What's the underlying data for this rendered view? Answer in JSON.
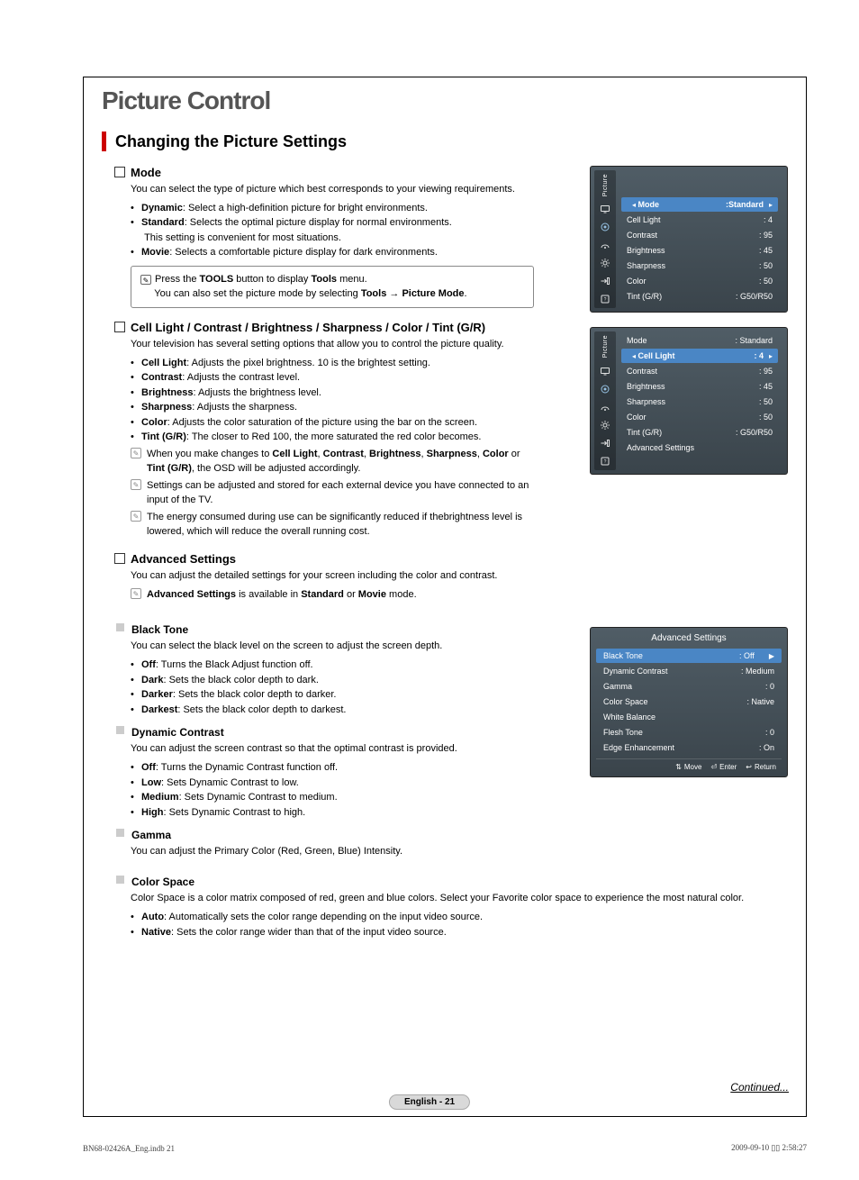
{
  "section_title": "Picture Control",
  "subsection_title": "Changing the Picture Settings",
  "mode": {
    "heading": "Mode",
    "intro": "You can select the type of picture which best corresponds to your viewing requirements.",
    "items": [
      {
        "name": "Dynamic",
        "desc": ": Select a high-definition picture for bright environments."
      },
      {
        "name": "Standard",
        "desc": ": Selects the optimal picture display for normal environments.",
        "desc2": "This setting is convenient for most situations."
      },
      {
        "name": "Movie",
        "desc": ": Selects a comfortable picture display for dark environments."
      }
    ],
    "note_line1_a": "Press the",
    "note_tools": "TOOLS",
    "note_line1_b": "button to display",
    "note_tools2": "Tools",
    "note_line1_c": "menu.",
    "note_line2_a": "You can also set the picture mode by selecting",
    "note_path": "Tools → Picture Mode"
  },
  "cell": {
    "heading": "Cell Light / Contrast / Brightness / Sharpness / Color / Tint (G/R)",
    "intro": "Your television has several setting options that allow you to control the picture quality.",
    "items": [
      {
        "name": "Cell Light",
        "desc": ": Adjusts the pixel brightness. 10 is the brightest setting."
      },
      {
        "name": "Contrast",
        "desc": ": Adjusts the contrast level."
      },
      {
        "name": "Brightness",
        "desc": ": Adjusts the brightness level."
      },
      {
        "name": "Sharpness",
        "desc": ": Adjusts the sharpness."
      },
      {
        "name": "Color",
        "desc": ": Adjusts the color saturation of the picture using the bar on the screen."
      },
      {
        "name": "Tint (G/R)",
        "desc": ": The closer to Red 100, the more saturated the red color becomes."
      }
    ],
    "note1_a": "When you make changes to",
    "note1_b": "Cell Light",
    "note1_c": "Contrast",
    "note1_d": "Brightness",
    "note1_e": "Sharpness",
    "note1_f": "Color",
    "note1_g": "or",
    "note1_h": "Tint (G/R)",
    "note1_i": ", the OSD will be adjusted accordingly.",
    "note2": "Settings can be adjusted and stored for each external device you have connected to an input of the TV.",
    "note3": "The energy consumed during use can be significantly reduced if thebrightness level is lowered, which will reduce the overall running cost."
  },
  "adv": {
    "heading": "Advanced Settings",
    "intro": "You can adjust the detailed settings for your screen including the color and contrast.",
    "note_bold": "Advanced Settings",
    "note_a": "is available in",
    "note_b": "Standard",
    "note_or": "or",
    "note_c": "Movie",
    "note_d": "mode."
  },
  "bt": {
    "heading": "Black Tone",
    "intro": "You can select the black level on the screen to adjust the screen depth.",
    "items": [
      {
        "name": "Off",
        "desc": ": Turns the Black Adjust function off."
      },
      {
        "name": "Dark",
        "desc": ": Sets the black color depth to dark."
      },
      {
        "name": "Darker",
        "desc": ": Sets the black color depth to darker."
      },
      {
        "name": "Darkest",
        "desc": ": Sets the black color depth to darkest."
      }
    ]
  },
  "dc": {
    "heading": "Dynamic Contrast",
    "intro": "You can adjust the screen contrast so that the optimal contrast is provided.",
    "items": [
      {
        "name": "Off",
        "desc": ": Turns the Dynamic Contrast function off."
      },
      {
        "name": "Low",
        "desc": ": Sets Dynamic Contrast to low."
      },
      {
        "name": "Medium",
        "desc": ": Sets Dynamic Contrast to medium."
      },
      {
        "name": "High",
        "desc": ": Sets Dynamic Contrast to high."
      }
    ]
  },
  "gamma": {
    "heading": "Gamma",
    "intro": "You can adjust the Primary Color (Red, Green, Blue) Intensity."
  },
  "cs": {
    "heading": "Color Space",
    "intro": "Color Space is a color matrix composed of red, green and blue colors. Select your Favorite color space to experience the most natural color.",
    "items": [
      {
        "name": "Auto",
        "desc": ": Automatically sets the color range depending on the input video source."
      },
      {
        "name": "Native",
        "desc": ": Sets the color range wider than that of the input video source."
      }
    ]
  },
  "osd1": {
    "side": "Picture",
    "rows": [
      {
        "lbl": "Mode",
        "val": ":Standard"
      },
      {
        "lbl": "Cell Light",
        "val": ": 4"
      },
      {
        "lbl": "Contrast",
        "val": ": 95"
      },
      {
        "lbl": "Brightness",
        "val": ": 45"
      },
      {
        "lbl": "Sharpness",
        "val": ": 50"
      },
      {
        "lbl": "Color",
        "val": ": 50"
      },
      {
        "lbl": "Tint (G/R)",
        "val": ": G50/R50"
      }
    ]
  },
  "osd2": {
    "side": "Picture",
    "rows": [
      {
        "lbl": "Mode",
        "val": ": Standard"
      },
      {
        "lbl": "Cell Light",
        "val": ": 4"
      },
      {
        "lbl": "Contrast",
        "val": ": 95"
      },
      {
        "lbl": "Brightness",
        "val": ": 45"
      },
      {
        "lbl": "Sharpness",
        "val": ": 50"
      },
      {
        "lbl": "Color",
        "val": ": 50"
      },
      {
        "lbl": "Tint (G/R)",
        "val": ": G50/R50"
      },
      {
        "lbl": "Advanced Settings"
      }
    ]
  },
  "osd3": {
    "title": "Advanced Settings",
    "rows": [
      {
        "lbl": "Black Tone",
        "val": ": Off"
      },
      {
        "lbl": "Dynamic Contrast",
        "val": ": Medium"
      },
      {
        "lbl": "Gamma",
        "val": ": 0"
      },
      {
        "lbl": "Color Space",
        "val": ": Native"
      },
      {
        "lbl": "White Balance"
      },
      {
        "lbl": "Flesh Tone",
        "val": ": 0"
      },
      {
        "lbl": "Edge Enhancement",
        "val": ": On"
      }
    ],
    "footer": [
      "Move",
      "Enter",
      "Return"
    ]
  },
  "continued": "Continued...",
  "page_num": "English - 21",
  "footer_left": "BN68-02426A_Eng.indb   21",
  "footer_right": "2009-09-10   ▯▯ 2:58:27"
}
